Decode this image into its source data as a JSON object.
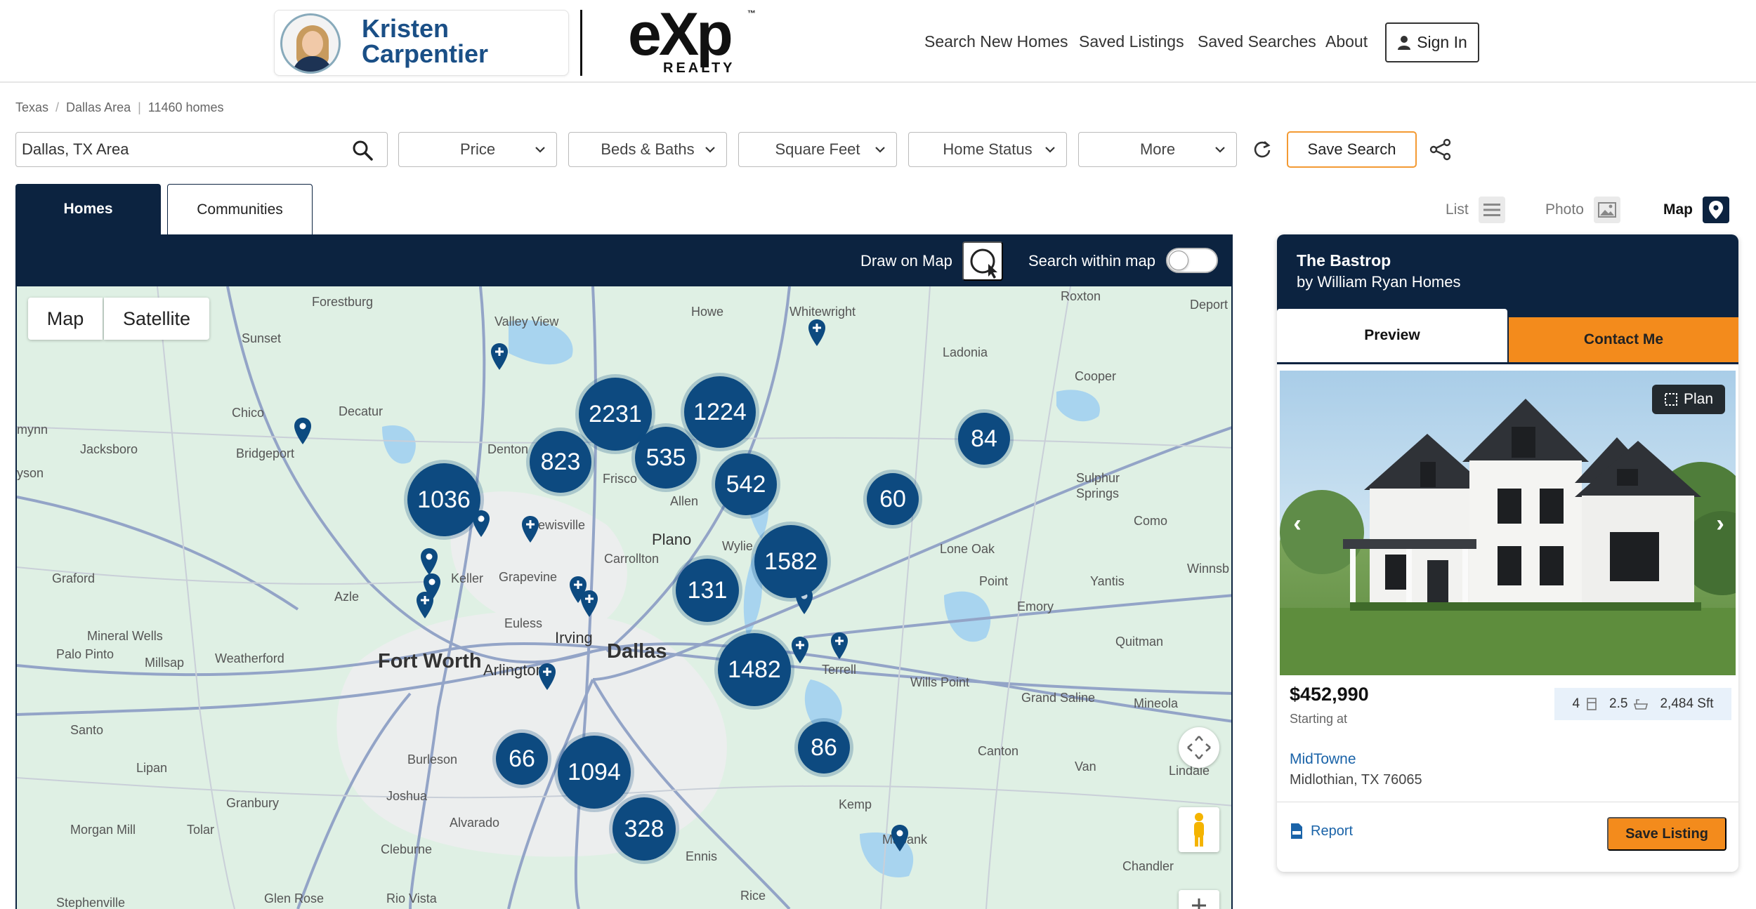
{
  "header": {
    "agent_first": "Kristen",
    "agent_last": "Carpentier",
    "logo_word": "eXp",
    "logo_sub": "REALTY",
    "logo_tm": "™",
    "nav": [
      "Search New Homes",
      "Saved Listings",
      "Saved Searches",
      "About"
    ],
    "sign_in": "Sign In"
  },
  "breadcrumb": {
    "state": "Texas",
    "area": "Dallas Area",
    "count": "11460 homes"
  },
  "filters": {
    "search_value": "Dallas, TX Area",
    "price": "Price",
    "beds_baths": "Beds & Baths",
    "square_feet": "Square Feet",
    "home_status": "Home Status",
    "more": "More",
    "save_search": "Save Search"
  },
  "tabs": {
    "homes": "Homes",
    "communities": "Communities"
  },
  "views": {
    "list": "List",
    "photo": "Photo",
    "map": "Map"
  },
  "map_bar": {
    "draw": "Draw on Map",
    "within": "Search within map",
    "within_on": false
  },
  "map": {
    "type_map": "Map",
    "type_satellite": "Satellite",
    "towns": {
      "forestburg": "Forestburg",
      "valley_view": "Valley View",
      "howe": "Howe",
      "whitewright": "Whitewright",
      "roxton": "Roxton",
      "deport": "Deport",
      "sunset": "Sunset",
      "ladonia": "Ladonia",
      "cooper": "Cooper",
      "chico": "Chico",
      "decatur": "Decatur",
      "bridgeport": "Bridgeport",
      "jacksboro": "Jacksboro",
      "denton": "Denton",
      "frisco": "Frisco",
      "allen": "Allen",
      "sulphur_springs": "Sulphur\nSprings",
      "lewisville": "Lewisville",
      "carrollton": "Carrollton",
      "plano": "Plano",
      "wylie": "Wylie",
      "como": "Como",
      "lone_oak": "Lone Oak",
      "keller": "Keller",
      "grapevine": "Grapevine",
      "graford": "Graford",
      "azle": "Azle",
      "yantis": "Yantis",
      "point": "Point",
      "winnsb": "Winnsb",
      "euless": "Euless",
      "emory": "Emory",
      "irving": "Irving",
      "mineral_wells": "Mineral Wells",
      "quitman": "Quitman",
      "palo_pinto": "Palo Pinto",
      "millsap": "Millsap",
      "weatherford": "Weatherford",
      "fort_worth": "Fort Worth",
      "arlington": "Arlington",
      "dallas": "Dallas",
      "terrell": "Terrell",
      "wills_point": "Wills Point",
      "grand_saline": "Grand Saline",
      "mineola": "Mineola",
      "santo": "Santo",
      "burleson": "Burleson",
      "canton": "Canton",
      "lipan": "Lipan",
      "van": "Van",
      "lindale": "Lindale",
      "granbury": "Granbury",
      "joshua": "Joshua",
      "kemp": "Kemp",
      "morgan_mill": "Morgan Mill",
      "tolar": "Tolar",
      "alvarado": "Alvarado",
      "cleburne": "Cleburne",
      "ennis": "Ennis",
      "chandler": "Chandler",
      "stephenville": "Stephenville",
      "glen_rose": "Glen Rose",
      "rio_vista": "Rio Vista",
      "rice": "Rice",
      "mabank": "Mabank",
      "mynn": "mynn",
      "ysona": "yson"
    },
    "clusters": [
      "2231",
      "1224",
      "823",
      "535",
      "84",
      "1036",
      "542",
      "60",
      "1582",
      "131",
      "1482",
      "66",
      "1094",
      "86",
      "328"
    ]
  },
  "listing": {
    "title": "The Bastrop",
    "builder": "by William Ryan Homes",
    "tab_preview": "Preview",
    "tab_contact": "Contact Me",
    "plan_badge": "Plan",
    "price": "$452,990",
    "starting": "Starting at",
    "beds": "4",
    "baths": "2.5",
    "sqft": "2,484 Sft",
    "community": "MidTowne",
    "address": "Midlothian, TX 76065",
    "report": "Report",
    "save_listing": "Save Listing"
  },
  "colors": {
    "navy": "#0c2340",
    "orange": "#f38b1c",
    "cluster": "#0d4a80",
    "link": "#1a63a8"
  }
}
